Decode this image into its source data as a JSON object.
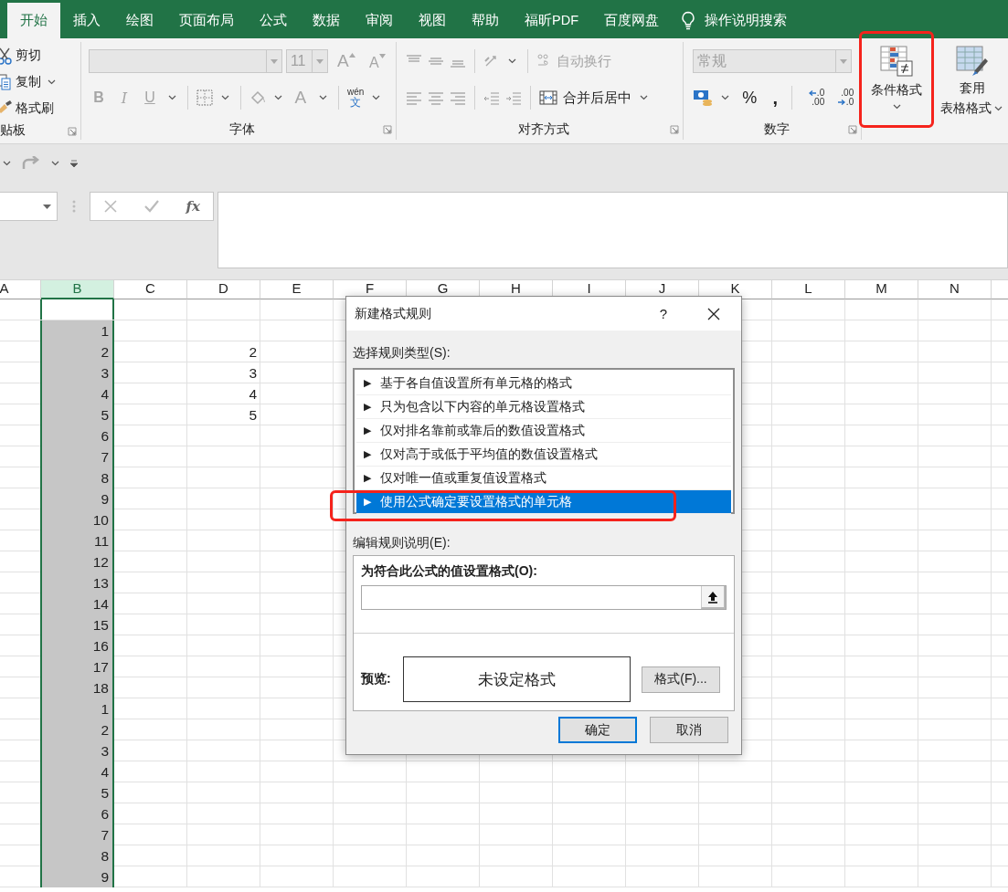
{
  "ribbon_tabs": [
    {
      "label": "开始",
      "selected": true
    },
    {
      "label": "插入",
      "selected": false
    },
    {
      "label": "绘图",
      "selected": false
    },
    {
      "label": "页面布局",
      "selected": false
    },
    {
      "label": "公式",
      "selected": false
    },
    {
      "label": "数据",
      "selected": false
    },
    {
      "label": "审阅",
      "selected": false
    },
    {
      "label": "视图",
      "selected": false
    },
    {
      "label": "帮助",
      "selected": false
    },
    {
      "label": "福昕PDF",
      "selected": false
    },
    {
      "label": "百度网盘",
      "selected": false
    }
  ],
  "tell_me": "操作说明搜索",
  "clipboard": {
    "label": "贴板",
    "cut": "剪切",
    "copy": "复制",
    "format_painter": "格式刷"
  },
  "font": {
    "label": "字体",
    "disabled": true,
    "font_size": "11",
    "grow_font": "A",
    "shrink_font": "A",
    "bold": "B",
    "italic": "I",
    "underline": "U",
    "font_color": "A",
    "phonetic_top": "wén",
    "phonetic_bottom": "文"
  },
  "alignment": {
    "label": "对齐方式",
    "wrap_text": {
      "label": "自动换行",
      "disabled": true
    },
    "merge_center": "合并后居中"
  },
  "number": {
    "label": "数字",
    "format": {
      "value": "常规",
      "disabled": true
    },
    "percent": "%",
    "comma": ",",
    "increase_decimal": [
      ".0",
      ".00"
    ],
    "decrease_decimal": [
      ".00",
      ".0"
    ]
  },
  "styles": {
    "conditional_format": {
      "label": "条件格式",
      "highlighted": true
    },
    "format_as_table": {
      "line_1": "套用",
      "line_2": "表格格式"
    }
  },
  "formula_bar": {
    "function_button": "fx"
  },
  "sheet": {
    "columns": [
      {
        "label": "A",
        "selected": false
      },
      {
        "label": "B",
        "selected": true
      },
      {
        "label": "C",
        "selected": false
      },
      {
        "label": "D",
        "selected": false
      },
      {
        "label": "E",
        "selected": false
      },
      {
        "label": "F",
        "selected": false
      },
      {
        "label": "G",
        "selected": false
      },
      {
        "label": "H",
        "selected": false
      },
      {
        "label": "I",
        "selected": false
      },
      {
        "label": "J",
        "selected": false
      },
      {
        "label": "K",
        "selected": false
      },
      {
        "label": "L",
        "selected": false
      },
      {
        "label": "M",
        "selected": false
      },
      {
        "label": "N",
        "selected": false
      }
    ],
    "rows": [
      {
        "active": true
      },
      {
        "active": false,
        "col_b": "1"
      },
      {
        "active": false,
        "col_b": "2",
        "col_d": "2"
      },
      {
        "active": false,
        "col_b": "3",
        "col_d": "3"
      },
      {
        "active": false,
        "col_b": "4",
        "col_d": "4"
      },
      {
        "active": false,
        "col_b": "5",
        "col_d": "5"
      },
      {
        "active": false,
        "col_b": "6"
      },
      {
        "active": false,
        "col_b": "7"
      },
      {
        "active": false,
        "col_b": "8"
      },
      {
        "active": false,
        "col_b": "9"
      },
      {
        "active": false,
        "col_b": "10"
      },
      {
        "active": false,
        "col_b": "11"
      },
      {
        "active": false,
        "col_b": "12"
      },
      {
        "active": false,
        "col_b": "13"
      },
      {
        "active": false,
        "col_b": "14"
      },
      {
        "active": false,
        "col_b": "15"
      },
      {
        "active": false,
        "col_b": "16"
      },
      {
        "active": false,
        "col_b": "17"
      },
      {
        "active": false,
        "col_b": "18"
      },
      {
        "active": false,
        "col_b": "1"
      },
      {
        "active": false,
        "col_b": "2"
      },
      {
        "active": false,
        "col_b": "3"
      },
      {
        "active": false,
        "col_b": "4"
      },
      {
        "active": false,
        "col_b": "5"
      },
      {
        "active": false,
        "col_b": "6"
      },
      {
        "active": false,
        "col_b": "7"
      },
      {
        "active": false,
        "col_b": "8"
      },
      {
        "active": false,
        "col_b": "9"
      }
    ]
  },
  "dialog": {
    "title": "新建格式规则",
    "help": "?",
    "rule_type_label": "选择规则类型(S):",
    "rule_types": [
      {
        "arrow": "▶",
        "label": "基于各自值设置所有单元格的格式",
        "selected": false,
        "highlighted": false
      },
      {
        "arrow": "▶",
        "label": "只为包含以下内容的单元格设置格式",
        "selected": false,
        "highlighted": false
      },
      {
        "arrow": "▶",
        "label": "仅对排名靠前或靠后的数值设置格式",
        "selected": false,
        "highlighted": false
      },
      {
        "arrow": "▶",
        "label": "仅对高于或低于平均值的数值设置格式",
        "selected": false,
        "highlighted": false
      },
      {
        "arrow": "▶",
        "label": "仅对唯一值或重复值设置格式",
        "selected": false,
        "highlighted": false
      },
      {
        "arrow": "▶",
        "label": "使用公式确定要设置格式的单元格",
        "selected": true,
        "highlighted": true
      }
    ],
    "edit_label": "编辑规则说明(E):",
    "formula_label": "为符合此公式的值设置格式(O):",
    "preview_label": "预览:",
    "preview_text": "未设定格式",
    "format_button": "格式(F)...",
    "ok_button": "确定",
    "cancel_button": "取消"
  }
}
